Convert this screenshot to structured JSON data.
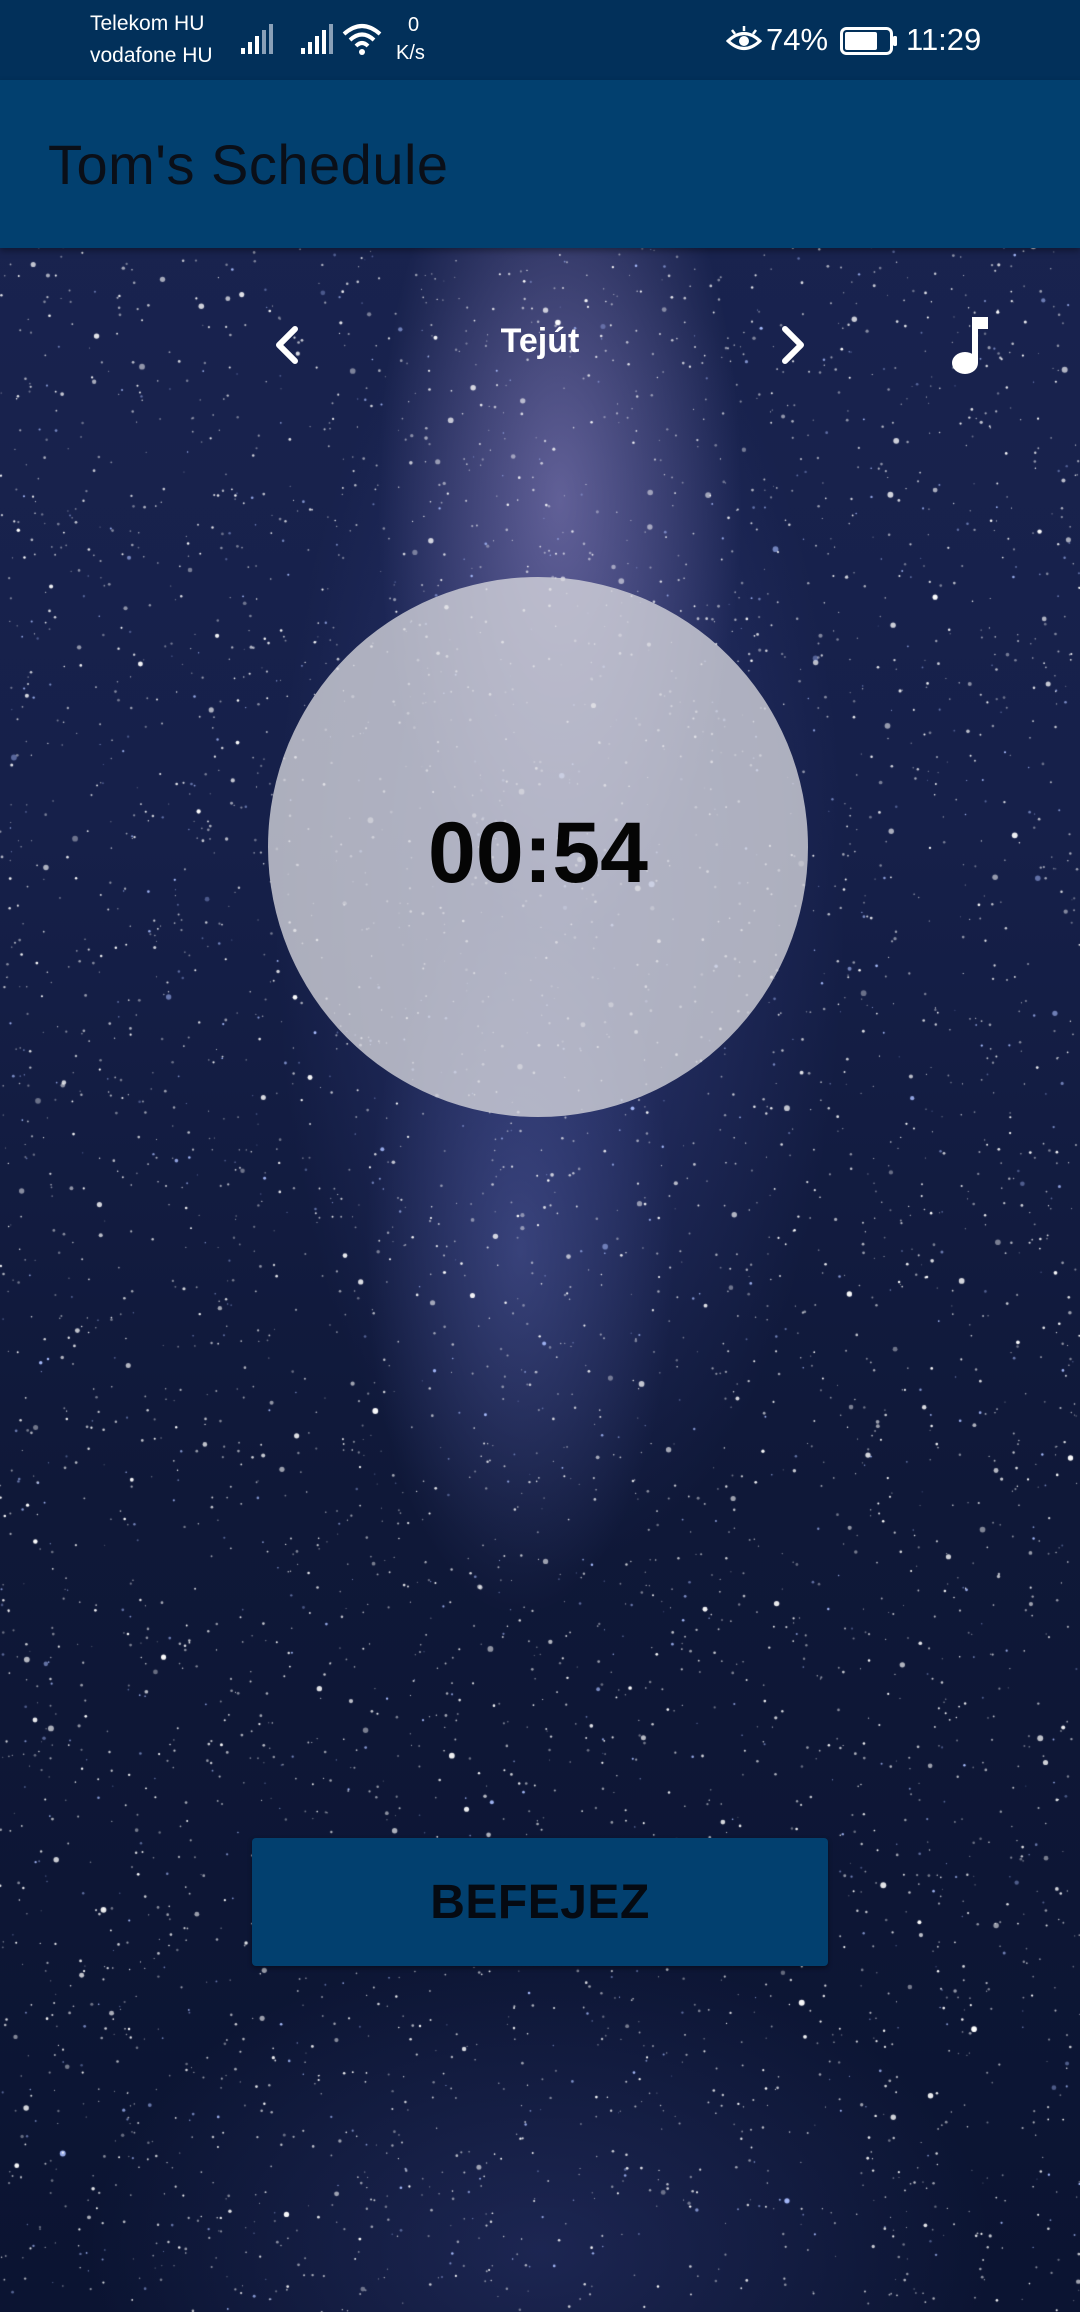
{
  "status_bar": {
    "carrier_1": "Telekom HU",
    "carrier_2": "vodafone HU",
    "net_speed_value": "0",
    "net_speed_unit": "K/s",
    "battery_percent": "74%",
    "battery_level": 0.74,
    "time": "11:29",
    "icons": [
      "signal-icon",
      "signal-icon",
      "wifi-icon",
      "eye-icon",
      "battery-icon"
    ]
  },
  "app_bar": {
    "title": "Tom's Schedule"
  },
  "player": {
    "track_name": "Tejút",
    "icons": {
      "prev": "chevron-left-icon",
      "next": "chevron-right-icon",
      "music": "music-note-icon"
    }
  },
  "timer": {
    "time": "00:54"
  },
  "actions": {
    "finish_label": "BEFEJEZ"
  },
  "colors": {
    "status_bar": "#02305a",
    "app_bar": "#02406f",
    "button": "#02406f",
    "circle": "#d7d7de"
  }
}
